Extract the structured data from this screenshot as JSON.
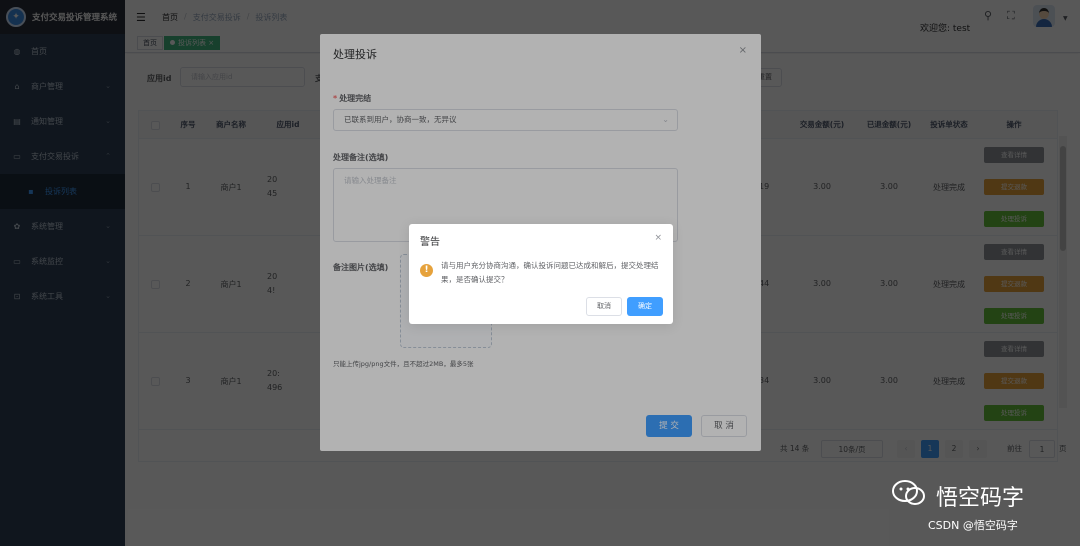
{
  "sidebar": {
    "title": "支付交易投诉管理系统",
    "items": [
      {
        "label": "首页",
        "icon": "dashboard-icon",
        "glyph": "◍"
      },
      {
        "label": "商户管理",
        "icon": "shop-icon",
        "glyph": "⌂",
        "arrow": "⌄"
      },
      {
        "label": "通知管理",
        "icon": "message-icon",
        "glyph": "▤",
        "arrow": "⌄"
      },
      {
        "label": "支付交易投诉",
        "icon": "monitor-icon",
        "glyph": "▭",
        "arrow": "⌃"
      },
      {
        "label": "投诉列表",
        "icon": "list-icon",
        "glyph": "▪"
      },
      {
        "label": "系统管理",
        "icon": "gear-icon",
        "glyph": "✿",
        "arrow": "⌄"
      },
      {
        "label": "系统监控",
        "icon": "monitor-icon",
        "glyph": "▭",
        "arrow": "⌄"
      },
      {
        "label": "系统工具",
        "icon": "tool-icon",
        "glyph": "⊡",
        "arrow": "⌄"
      }
    ]
  },
  "navbar": {
    "breadcrumb": [
      "首页",
      "支付交易投诉",
      "投诉列表"
    ],
    "welcome": "欢迎您: test",
    "search_glyph": "⚲",
    "fullscreen_glyph": "⛶"
  },
  "tags": {
    "home": "首页",
    "active": "投诉列表",
    "close": "×"
  },
  "filter": {
    "app_id_label": "应用id",
    "app_id_placeholder": "请输入应用id",
    "second_label": "支",
    "reset": "重置"
  },
  "table": {
    "headers": {
      "index": "序号",
      "merchant": "商户名称",
      "app_id": "应用id",
      "trade_amount": "交易金额(元)",
      "refund_amount": "已退金额(元)",
      "status": "投诉单状态",
      "ops": "操作"
    },
    "rows": [
      {
        "index": "1",
        "merchant": "商户1",
        "app_id_a": "20",
        "app_id_b": "45",
        "partial": "19",
        "trade_amount": "3.00",
        "refund_amount": "3.00",
        "status": "处理完成"
      },
      {
        "index": "2",
        "merchant": "商户1",
        "app_id_a": "20",
        "app_id_b": "4!",
        "partial": "44",
        "trade_amount": "3.00",
        "refund_amount": "3.00",
        "status": "处理完成"
      },
      {
        "index": "3",
        "merchant": "商户1",
        "app_id_a": "20:",
        "app_id_b": "496",
        "partial": "34",
        "trade_amount": "3.00",
        "refund_amount": "3.00",
        "status": "处理完成"
      }
    ],
    "ops": {
      "view": "查看详情",
      "refund": "提交退款",
      "handle": "处理投诉"
    }
  },
  "pagination": {
    "total": "共 14 条",
    "page_size": "10条/页",
    "pages": [
      "1",
      "2"
    ],
    "goto_label": "前往",
    "goto_value": "1",
    "page_suffix": "页"
  },
  "dialog": {
    "title": "处理投诉",
    "result_label": "处理完结",
    "result_value": "已联系到用户，协商一致，无异议",
    "note_label": "处理备注(选填)",
    "note_placeholder": "请输入处理备注",
    "image_label": "备注图片(选填)",
    "upload_tip": "只能上传jpg/png文件，且不超过2MB，最多5张",
    "submit": "提 交",
    "cancel": "取 消"
  },
  "msgbox": {
    "title": "警告",
    "text": "请与用户充分协商沟通，确认投诉问题已达成和解后，提交处理结果，是否确认提交？",
    "cancel": "取消",
    "ok": "确定"
  },
  "watermark": {
    "brand": "悟空码字",
    "csdn": "CSDN @悟空码字"
  },
  "colors": {
    "primary": "#409eff",
    "sidebar": "#304156",
    "success": "#67c23a",
    "warning": "#e6a23c",
    "tag_active": "#42b983"
  }
}
